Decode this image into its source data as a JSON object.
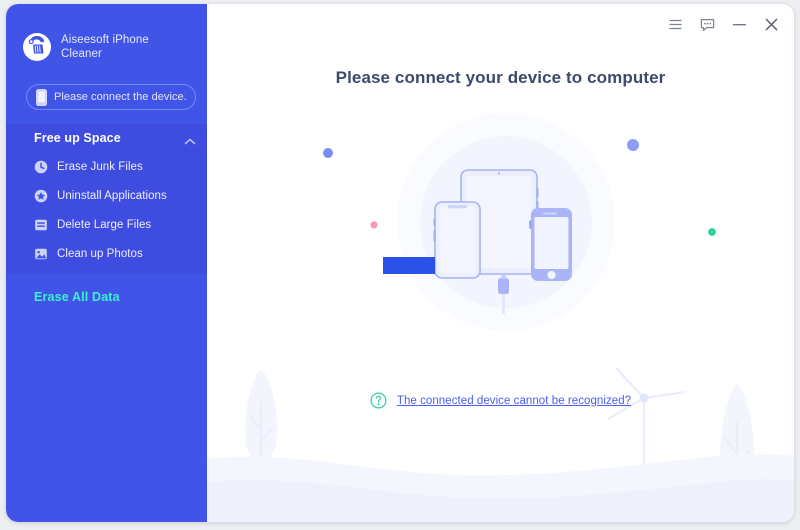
{
  "app": {
    "brand_name": "Aiseesoft iPhone\nCleaner",
    "logo_icon": "broom-cleaner-icon"
  },
  "sidebar": {
    "device_status": {
      "label": "Please connect the device.",
      "icon": "phone-icon"
    },
    "section": {
      "title": "Free up Space",
      "collapse_icon": "chevron-up-icon",
      "items": [
        {
          "label": "Erase Junk Files",
          "icon": "clock-icon"
        },
        {
          "label": "Uninstall Applications",
          "icon": "star-circle-icon"
        },
        {
          "label": "Delete Large Files",
          "icon": "file-list-icon"
        },
        {
          "label": "Clean up Photos",
          "icon": "photo-icon"
        }
      ]
    },
    "erase_all_data": "Erase All Data"
  },
  "titlebar": {
    "menu_label": "menu-icon",
    "feedback_label": "feedback-bubble-icon",
    "minimize_label": "minimize-icon",
    "close_label": "close-icon"
  },
  "main": {
    "page_title": "Please connect your device to computer",
    "help_icon": "question-mark-circle-icon",
    "help_link": "The connected device cannot be recognized?"
  },
  "colors": {
    "sidebar_blue": "#4154e8",
    "section_blue": "#3f4ce0",
    "accent_cyan": "#3ff0cd",
    "title_navy": "#3c4a6b",
    "link_blue": "#4a5ef0",
    "device_stroke": "#97a4f5",
    "device_fill": "#eef0fe",
    "dot_blue": "#7b8cf5",
    "dot_green": "#2ad4a4",
    "dot_pink": "#f59ab8",
    "rect_blue": "#2a52e8",
    "scenery": "#f2f4fd"
  }
}
